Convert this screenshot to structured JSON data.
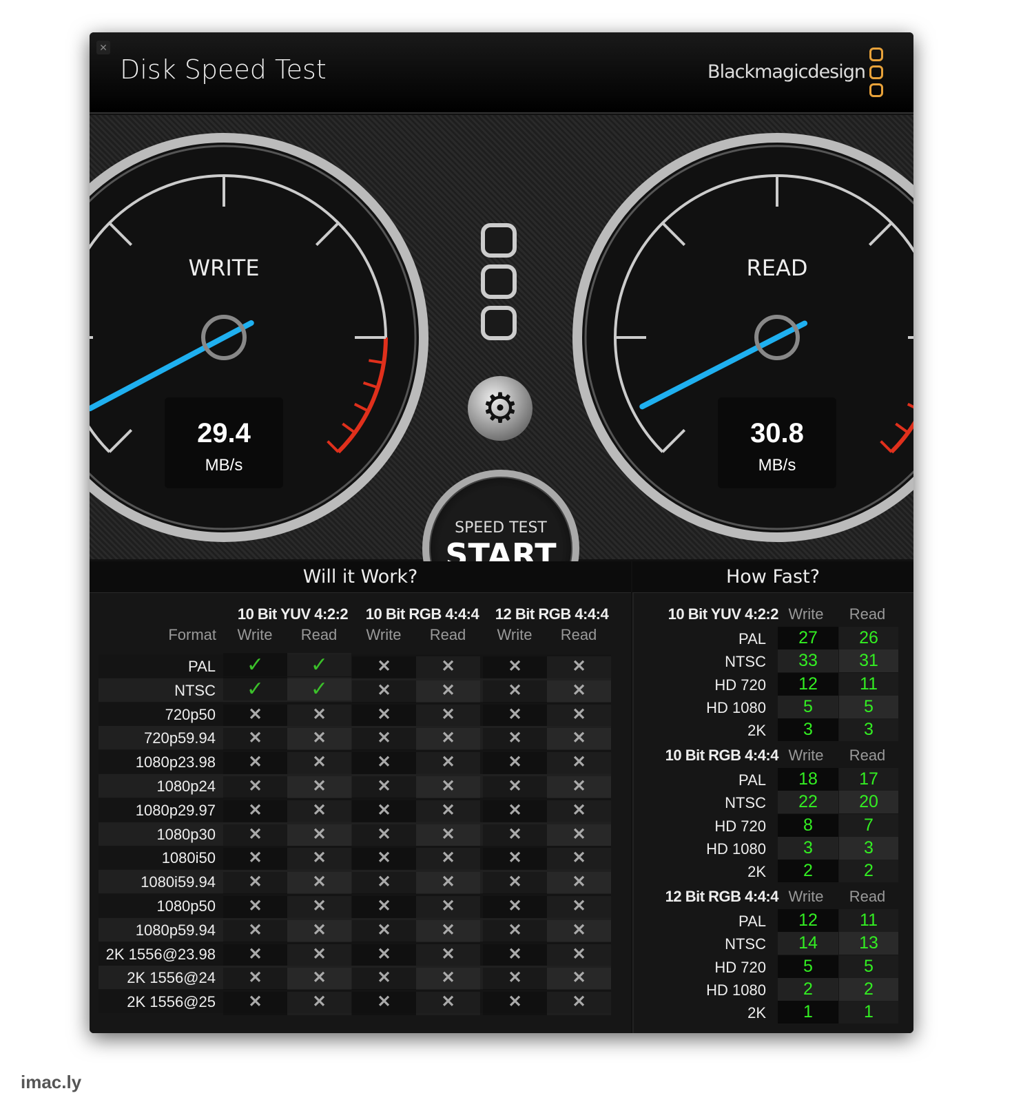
{
  "window": {
    "title": "Disk Speed Test",
    "brand": "Blackmagicdesign",
    "close_icon": "close-icon"
  },
  "colors": {
    "needle": "#1fb0f0",
    "redzone": "#e0301c",
    "ok": "#3bc02a",
    "speed": "#33ee22",
    "logo": "#e8a23a"
  },
  "gauges": {
    "write": {
      "label": "WRITE",
      "value": "29.4",
      "unit": "MB/s"
    },
    "read": {
      "label": "READ",
      "value": "30.8",
      "unit": "MB/s"
    }
  },
  "start_button": {
    "line1": "SPEED TEST",
    "line2": "START"
  },
  "settings_icon": "gear-icon",
  "will_it_work": {
    "title": "Will it Work?",
    "format_header": "Format",
    "groups": [
      "10 Bit YUV 4:2:2",
      "10 Bit RGB 4:4:4",
      "12 Bit RGB 4:4:4"
    ],
    "subheaders": [
      "Write",
      "Read",
      "Write",
      "Read",
      "Write",
      "Read"
    ],
    "rows": [
      {
        "format": "PAL",
        "results": [
          true,
          true,
          false,
          false,
          false,
          false
        ]
      },
      {
        "format": "NTSC",
        "results": [
          true,
          true,
          false,
          false,
          false,
          false
        ]
      },
      {
        "format": "720p50",
        "results": [
          false,
          false,
          false,
          false,
          false,
          false
        ]
      },
      {
        "format": "720p59.94",
        "results": [
          false,
          false,
          false,
          false,
          false,
          false
        ]
      },
      {
        "format": "1080p23.98",
        "results": [
          false,
          false,
          false,
          false,
          false,
          false
        ]
      },
      {
        "format": "1080p24",
        "results": [
          false,
          false,
          false,
          false,
          false,
          false
        ]
      },
      {
        "format": "1080p29.97",
        "results": [
          false,
          false,
          false,
          false,
          false,
          false
        ]
      },
      {
        "format": "1080p30",
        "results": [
          false,
          false,
          false,
          false,
          false,
          false
        ]
      },
      {
        "format": "1080i50",
        "results": [
          false,
          false,
          false,
          false,
          false,
          false
        ]
      },
      {
        "format": "1080i59.94",
        "results": [
          false,
          false,
          false,
          false,
          false,
          false
        ]
      },
      {
        "format": "1080p50",
        "results": [
          false,
          false,
          false,
          false,
          false,
          false
        ]
      },
      {
        "format": "1080p59.94",
        "results": [
          false,
          false,
          false,
          false,
          false,
          false
        ]
      },
      {
        "format": "2K 1556@23.98",
        "results": [
          false,
          false,
          false,
          false,
          false,
          false
        ]
      },
      {
        "format": "2K 1556@24",
        "results": [
          false,
          false,
          false,
          false,
          false,
          false
        ]
      },
      {
        "format": "2K 1556@25",
        "results": [
          false,
          false,
          false,
          false,
          false,
          false
        ]
      }
    ]
  },
  "how_fast": {
    "title": "How Fast?",
    "groups": [
      {
        "name": "10 Bit YUV 4:2:2",
        "write": "Write",
        "read": "Read",
        "rows": [
          {
            "format": "PAL",
            "write": "27",
            "read": "26"
          },
          {
            "format": "NTSC",
            "write": "33",
            "read": "31"
          },
          {
            "format": "HD 720",
            "write": "12",
            "read": "11"
          },
          {
            "format": "HD 1080",
            "write": "5",
            "read": "5"
          },
          {
            "format": "2K",
            "write": "3",
            "read": "3"
          }
        ]
      },
      {
        "name": "10 Bit RGB 4:4:4",
        "write": "Write",
        "read": "Read",
        "rows": [
          {
            "format": "PAL",
            "write": "18",
            "read": "17"
          },
          {
            "format": "NTSC",
            "write": "22",
            "read": "20"
          },
          {
            "format": "HD 720",
            "write": "8",
            "read": "7"
          },
          {
            "format": "HD 1080",
            "write": "3",
            "read": "3"
          },
          {
            "format": "2K",
            "write": "2",
            "read": "2"
          }
        ]
      },
      {
        "name": "12 Bit RGB 4:4:4",
        "write": "Write",
        "read": "Read",
        "rows": [
          {
            "format": "PAL",
            "write": "12",
            "read": "11"
          },
          {
            "format": "NTSC",
            "write": "14",
            "read": "13"
          },
          {
            "format": "HD 720",
            "write": "5",
            "read": "5"
          },
          {
            "format": "HD 1080",
            "write": "2",
            "read": "2"
          },
          {
            "format": "2K",
            "write": "1",
            "read": "1"
          }
        ]
      }
    ]
  },
  "watermark": "imac.ly"
}
